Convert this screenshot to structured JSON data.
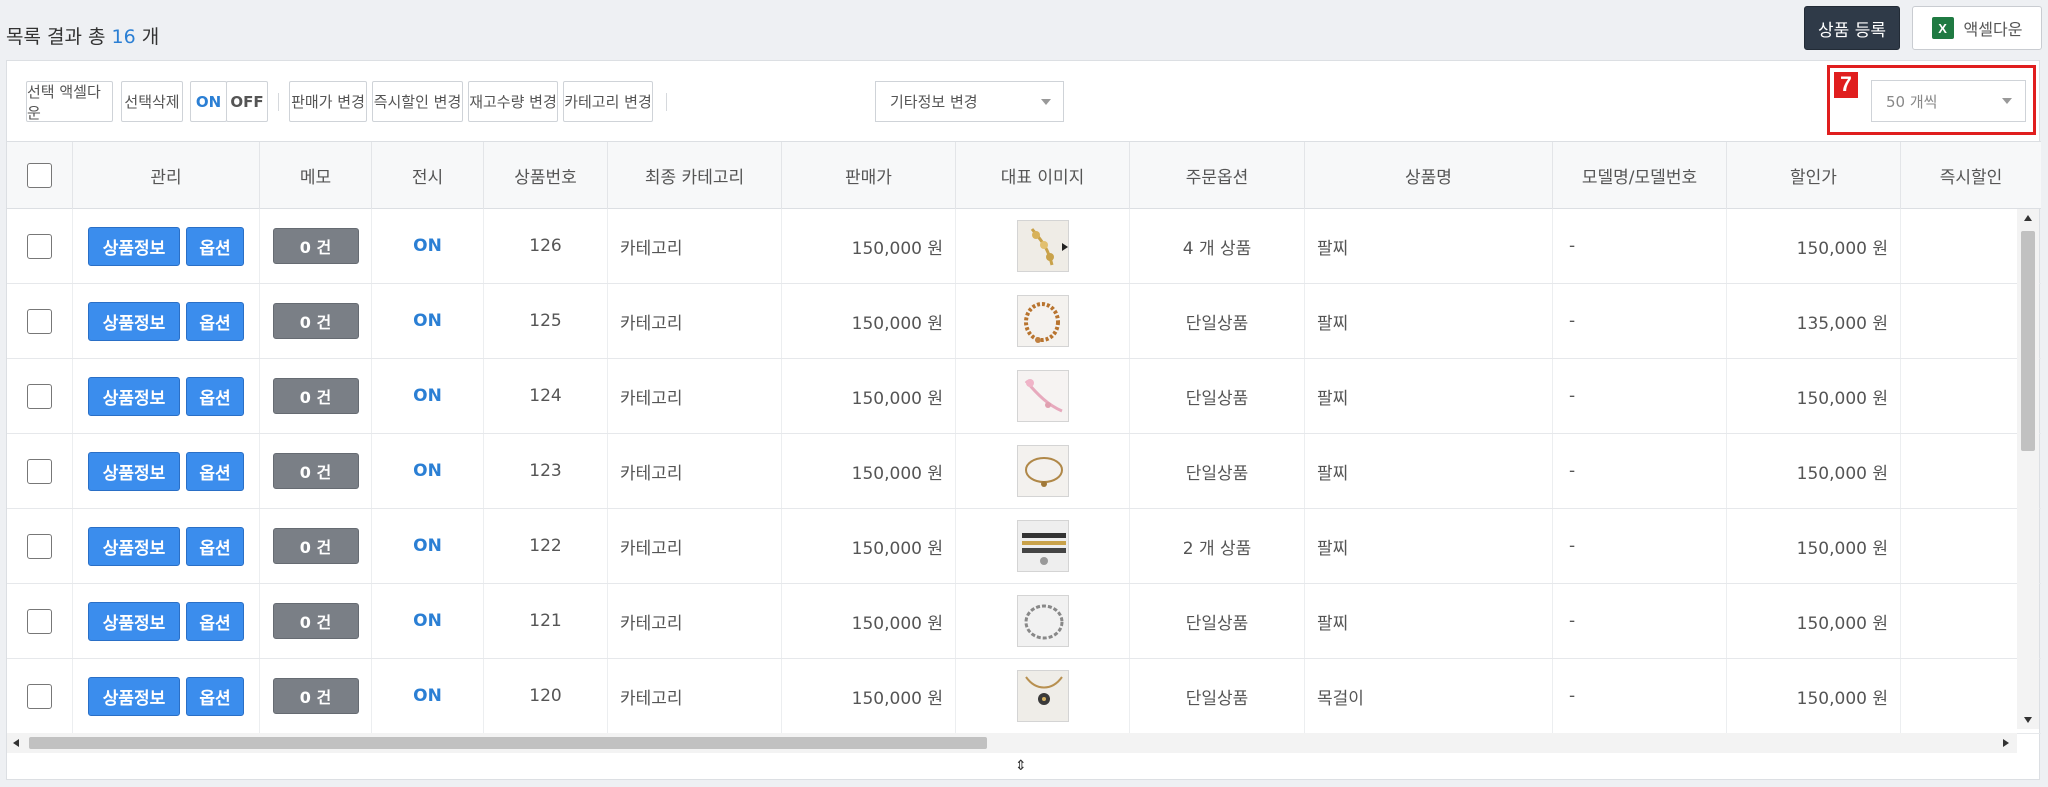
{
  "header": {
    "result_prefix": "목록 결과 총",
    "result_count": "16",
    "result_suffix": "개",
    "register_label": "상품 등록",
    "excel_label": "액셀다운",
    "excel_icon": "excel-icon"
  },
  "toolbar": {
    "select_excel": "선택 액셀다운",
    "select_delete": "선택삭제",
    "on": "ON",
    "off": "OFF",
    "price_change": "판매가 변경",
    "instant_discount_change": "즉시할인 변경",
    "stock_change": "재고수량 변경",
    "category_change": "카테고리 변경",
    "etc_select": "기타정보 변경",
    "page_size": "50 개씩",
    "marker_number": "7"
  },
  "columns": [
    "관리",
    "메모",
    "전시",
    "상품번호",
    "최종 카테고리",
    "판매가",
    "대표 이미지",
    "주문옵션",
    "상품명",
    "모델명/모델번호",
    "할인가",
    "즉시할인"
  ],
  "row_buttons": {
    "info": "상품정보",
    "option": "옵션"
  },
  "rows": [
    {
      "memo": "0 건",
      "display": "ON",
      "id": "126",
      "category": "카테고리",
      "price": "150,000 원",
      "options": "4 개 상품",
      "name": "팔찌",
      "model": "-",
      "sale": "150,000 원",
      "thumb": "gold-bracelet-beads"
    },
    {
      "memo": "0 건",
      "display": "ON",
      "id": "125",
      "category": "카테고리",
      "price": "150,000 원",
      "options": "단일상품",
      "name": "팔찌",
      "model": "-",
      "sale": "135,000 원",
      "thumb": "beaded-bracelet"
    },
    {
      "memo": "0 건",
      "display": "ON",
      "id": "124",
      "category": "카테고리",
      "price": "150,000 원",
      "options": "단일상품",
      "name": "팔찌",
      "model": "-",
      "sale": "150,000 원",
      "thumb": "pink-bracelet"
    },
    {
      "memo": "0 건",
      "display": "ON",
      "id": "123",
      "category": "카테고리",
      "price": "150,000 원",
      "options": "단일상품",
      "name": "팔찌",
      "model": "-",
      "sale": "150,000 원",
      "thumb": "chain-bracelet"
    },
    {
      "memo": "0 건",
      "display": "ON",
      "id": "122",
      "category": "카테고리",
      "price": "150,000 원",
      "options": "2 개 상품",
      "name": "팔찌",
      "model": "-",
      "sale": "150,000 원",
      "thumb": "stacked-bangles"
    },
    {
      "memo": "0 건",
      "display": "ON",
      "id": "121",
      "category": "카테고리",
      "price": "150,000 원",
      "options": "단일상품",
      "name": "팔찌",
      "model": "-",
      "sale": "150,000 원",
      "thumb": "silver-bracelet"
    },
    {
      "memo": "0 건",
      "display": "ON",
      "id": "120",
      "category": "카테고리",
      "price": "150,000 원",
      "options": "단일상품",
      "name": "목걸이",
      "model": "-",
      "sale": "150,000 원",
      "thumb": "pendant-necklace"
    }
  ]
}
